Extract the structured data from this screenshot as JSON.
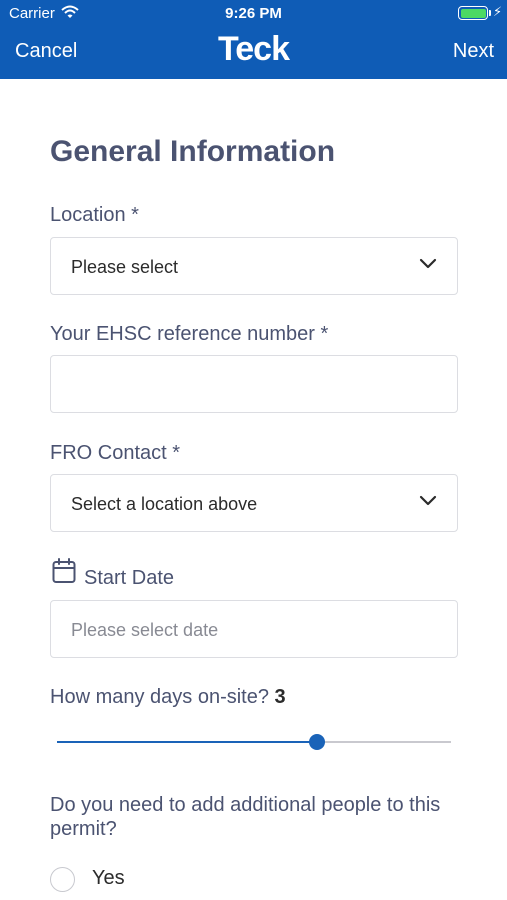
{
  "status_bar": {
    "carrier": "Carrier",
    "time": "9:26 PM",
    "battery_level": 1.0
  },
  "nav": {
    "cancel_label": "Cancel",
    "brand": "Teck",
    "next_label": "Next"
  },
  "form": {
    "title": "General Information",
    "location": {
      "label": "Location *",
      "value": "Please select"
    },
    "ehsc": {
      "label": "Your EHSC reference number *",
      "value": ""
    },
    "fro_contact": {
      "label": "FRO Contact *",
      "value": "Select a location above"
    },
    "start_date": {
      "label": "Start Date",
      "placeholder": "Please select date"
    },
    "days_on_site": {
      "label": "How many days on-site?",
      "value": "3",
      "slider_fraction": 0.66
    },
    "additional_people": {
      "question": "Do you need to add additional people to this permit?",
      "options": [
        "Yes"
      ]
    }
  },
  "colors": {
    "header": "#0f5cb6",
    "accent": "#1a63b8",
    "battery": "#4cd964"
  },
  "icons": [
    "wifi-icon",
    "battery-icon",
    "chevron-down-icon",
    "calendar-icon"
  ]
}
